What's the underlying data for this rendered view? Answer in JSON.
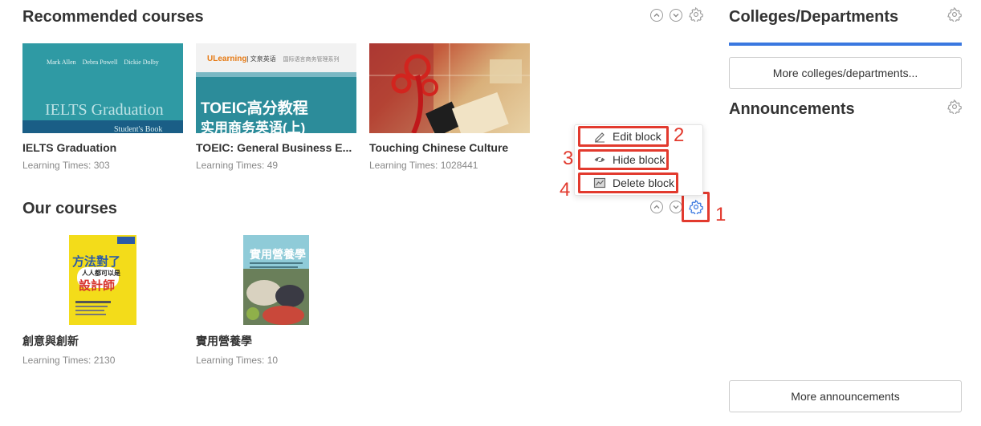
{
  "recommended": {
    "title": "Recommended courses",
    "courses": [
      {
        "title": "IELTS Graduation",
        "meta": "Learning Times: 303",
        "cover_authors": "Mark Allen    Debra Powell    Dickie Dolby",
        "cover_title": "IELTS Graduation",
        "cover_sub": "Student's Book"
      },
      {
        "title": "TOEIC: General Business E...",
        "meta": "Learning Times: 49",
        "cover_brand": "ULearning",
        "cover_brand_sub": "| 文泉英语",
        "cover_series": "国际语言商务管理系列",
        "cover_line1": "TOEIC高分教程",
        "cover_line2": "实用商务英语(上)"
      },
      {
        "title": "Touching Chinese Culture",
        "meta": "Learning Times: 1028441"
      }
    ]
  },
  "ours": {
    "title": "Our courses",
    "courses": [
      {
        "title": "創意與創新",
        "meta": "Learning Times: 2130",
        "cover_line1": "方法對了",
        "cover_line2": "人人都可以是",
        "cover_line3": "設計師"
      },
      {
        "title": "實用營養學",
        "meta": "Learning Times: 10",
        "cover_line1": "實用營養學"
      }
    ]
  },
  "menu": {
    "edit": "Edit block",
    "hide": "Hide block",
    "delete": "Delete block"
  },
  "markers": {
    "m1": "1",
    "m2": "2",
    "m3": "3",
    "m4": "4"
  },
  "sidebar": {
    "colleges_title": "Colleges/Departments",
    "colleges_more": "More colleges/departments...",
    "announcements_title": "Announcements",
    "announcements_more": "More announcements"
  },
  "colors": {
    "accent": "#3a78e0",
    "highlight": "#e23a2e"
  }
}
